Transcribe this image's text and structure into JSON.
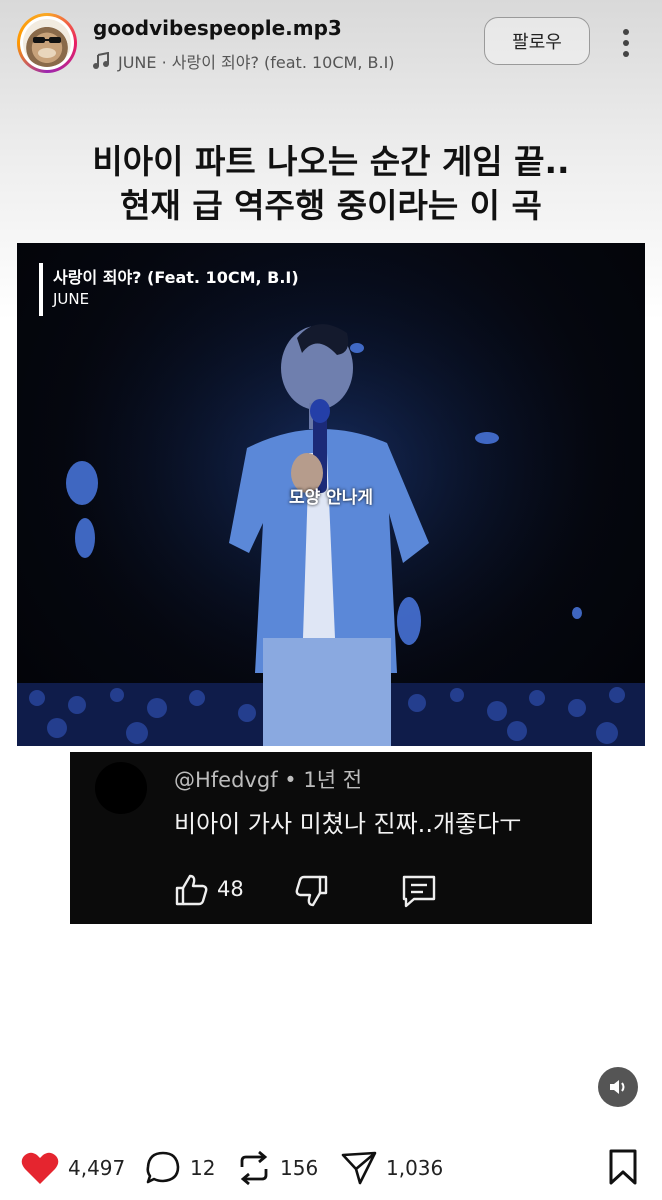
{
  "post": {
    "username": "goodvibespeople.mp3",
    "music": "JUNE · 사랑이 죄야? (feat. 10CM, B.I)",
    "follow_label": "팔로우",
    "headline_line1": "비아이 파트 나오는 순간 게임 끝..",
    "headline_line2": "현재 급 역주행 중이라는 이 곡"
  },
  "video": {
    "song_title": "사랑이 죄야? (Feat. 10CM, B.I)",
    "artist": "JUNE",
    "subtitle": "모양 안나게"
  },
  "comment": {
    "author": "@Hfedvgf",
    "time": "• 1년 전",
    "text": "비아이 가사 미쳤나 진짜..개좋다ㅜ",
    "likes": "48"
  },
  "actions": {
    "likes": "4,497",
    "comments": "12",
    "reposts": "156",
    "shares": "1,036"
  },
  "colors": {
    "heart": "#e5252f",
    "comment_card_bg": "#0b0b0b"
  },
  "icons": [
    "music-note-icon",
    "more-vertical-icon",
    "thumbs-up-icon",
    "thumbs-down-icon",
    "reply-icon",
    "volume-icon",
    "heart-icon",
    "comment-icon",
    "repost-icon",
    "share-icon",
    "bookmark-icon"
  ]
}
